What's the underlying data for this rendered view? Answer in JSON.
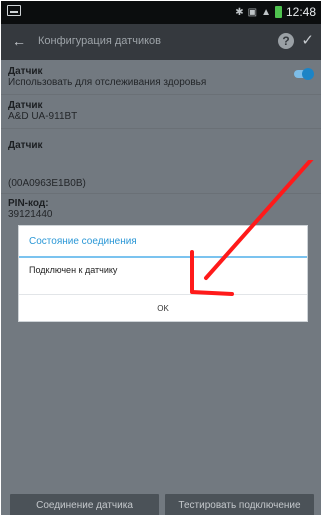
{
  "statusbar": {
    "time": "12:48",
    "bluetooth_icon": "bluetooth-icon",
    "signal_icon": "signal-icon",
    "battery_icon": "battery-icon"
  },
  "actionbar": {
    "back_icon": "back-arrow-icon",
    "title": "Конфигурация датчиков",
    "help_icon": "help-icon",
    "confirm_icon": "check-icon"
  },
  "settings": {
    "health_label": "Датчик",
    "health_value": "Использовать для отслеживания здоровья",
    "model_label": "Датчик",
    "model_value": "A&D UA-911BT",
    "id_label": "Датчик",
    "id_value": "(00A0963E1B0B)",
    "pin_label": "PIN-код:",
    "pin_value": "39121440"
  },
  "dialog": {
    "title": "Состояние соединения",
    "message": "Подключен к датчику",
    "ok": "OK"
  },
  "bottom": {
    "pair_button": "Соединение датчика",
    "test_button": "Тестировать подключение"
  },
  "colors": {
    "accent": "#2a97d6",
    "arrow": "#ff1a1a"
  }
}
